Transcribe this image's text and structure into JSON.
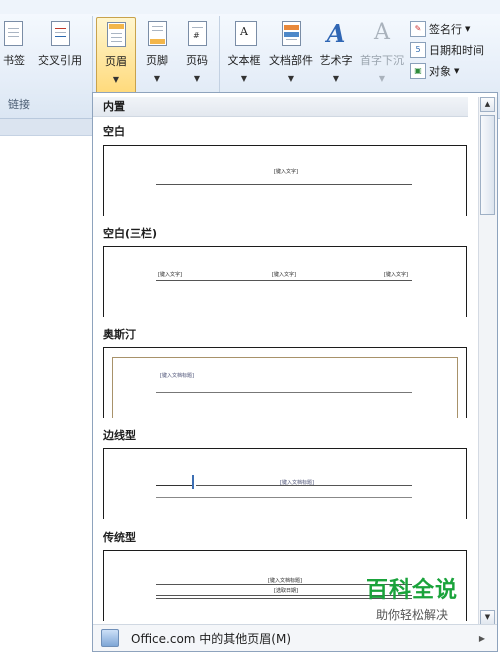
{
  "ribbon": {
    "buttons": [
      {
        "label": "书签"
      },
      {
        "label": "交叉引用"
      },
      {
        "label": "页眉"
      },
      {
        "label": "页脚"
      },
      {
        "label": "页码"
      },
      {
        "label": "文本框"
      },
      {
        "label": "文档部件"
      },
      {
        "label": "艺术字"
      },
      {
        "label": "首字下沉"
      }
    ],
    "small_buttons": [
      {
        "label": "签名行"
      },
      {
        "label": "日期和时间"
      },
      {
        "label": "对象"
      }
    ],
    "group_label": "链接"
  },
  "gallery": {
    "section": "内置",
    "items": [
      {
        "title": "空白",
        "placeholder": "[键入文字]"
      },
      {
        "title": "空白(三栏)",
        "placeholders": [
          "[键入文字]",
          "[键入文字]",
          "[键入文字]"
        ]
      },
      {
        "title": "奥斯汀",
        "placeholder": "[键入文档标题]"
      },
      {
        "title": "边线型",
        "placeholder": "[键入文档标题]"
      },
      {
        "title": "传统型",
        "placeholder": "[键入文档标题]",
        "placeholder2": "[选取日期]"
      }
    ],
    "footer": "Office.com 中的其他页眉(M)"
  },
  "watermark": {
    "title": "百科全说",
    "subtitle": "助你轻松解决"
  },
  "colors": {
    "accent_active": "#ffd978",
    "watermark_green": "#1aa33b"
  }
}
